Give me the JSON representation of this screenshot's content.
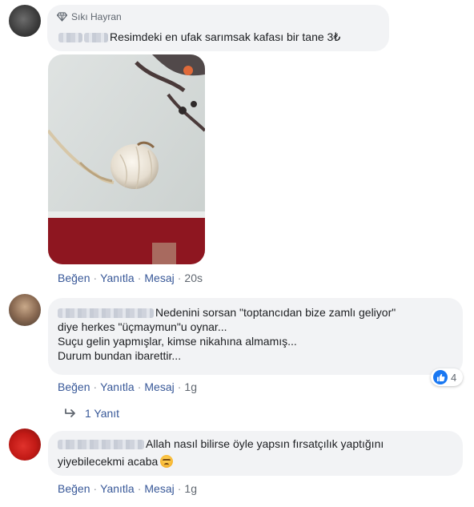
{
  "comments": [
    {
      "badge": "Sıkı Hayran",
      "text": "Resimdeki en ufak sarımsak kafası bir tane 3₺",
      "actions": {
        "like": "Beğen",
        "reply": "Yanıtla",
        "message": "Mesaj",
        "time": "20s"
      }
    },
    {
      "lines": [
        "Nedenini sorsan \"toptancıdan bize zamlı geliyor\"",
        "diye herkes \"üçmaymun\"u oynar...",
        "Suçu gelin yapmışlar, kimse nikahına almamış...",
        "Durum bundan ibarettir..."
      ],
      "reaction_count": "4",
      "reaction_icon": "like-icon",
      "actions": {
        "like": "Beğen",
        "reply": "Yanıtla",
        "message": "Mesaj",
        "time": "1g"
      },
      "replies_label": "1 Yanıt"
    },
    {
      "lines": [
        "Allah nasıl bilirse öyle yapsın fırsatçılık yaptığını",
        "yiyebilecekmi acaba"
      ],
      "emoji": "angry-emoji",
      "actions": {
        "like": "Beğen",
        "reply": "Yanıtla",
        "message": "Mesaj",
        "time": "1g"
      }
    }
  ],
  "colors": {
    "bubble": "#f2f3f5",
    "link": "#385898",
    "meta": "#606770",
    "like": "#1877f2"
  }
}
